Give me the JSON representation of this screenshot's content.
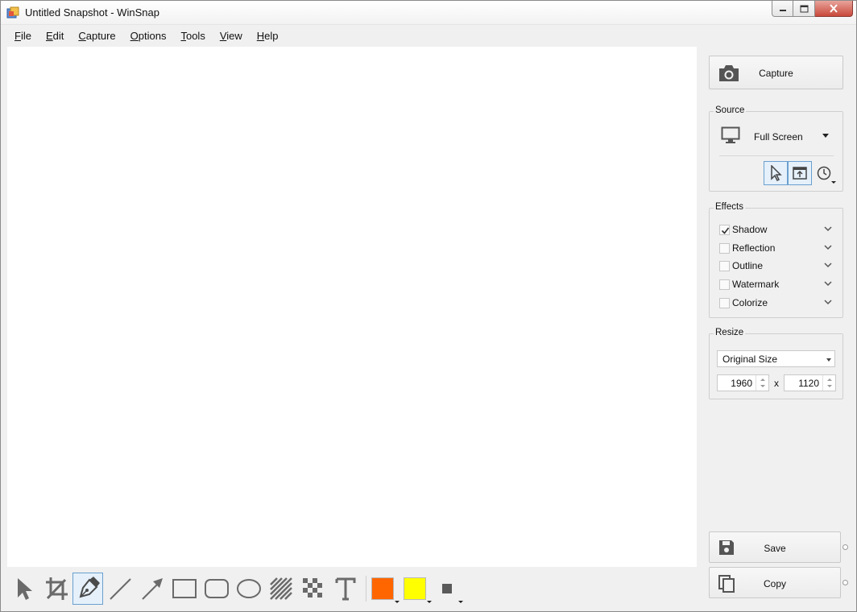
{
  "window": {
    "title": "Untitled Snapshot - WinSnap"
  },
  "menu": [
    {
      "label": "File",
      "accel": "F",
      "rest": "ile"
    },
    {
      "label": "Edit",
      "accel": "E",
      "rest": "dit"
    },
    {
      "label": "Capture",
      "accel": "C",
      "rest": "apture"
    },
    {
      "label": "Options",
      "accel": "O",
      "rest": "ptions"
    },
    {
      "label": "Tools",
      "accel": "T",
      "rest": "ools"
    },
    {
      "label": "View",
      "accel": "V",
      "rest": "iew"
    },
    {
      "label": "Help",
      "accel": "H",
      "rest": "elp"
    }
  ],
  "capture": {
    "label": "Capture",
    "icon": "camera-icon"
  },
  "source": {
    "title": "Source",
    "selected": "Full Screen",
    "icon": "monitor-icon",
    "modes": [
      "cursor-mode-icon",
      "window-mode-icon",
      "timer-icon"
    ]
  },
  "effects": {
    "title": "Effects",
    "items": [
      {
        "label": "Shadow",
        "checked": true
      },
      {
        "label": "Reflection",
        "checked": false
      },
      {
        "label": "Outline",
        "checked": false
      },
      {
        "label": "Watermark",
        "checked": false
      },
      {
        "label": "Colorize",
        "checked": false
      }
    ]
  },
  "resize": {
    "title": "Resize",
    "mode": "Original Size",
    "width": "1960",
    "separator": "x",
    "height": "1120"
  },
  "actions": {
    "save_label": "Save",
    "copy_label": "Copy"
  },
  "toolbar": {
    "tools": [
      "select-tool-icon",
      "crop-tool-icon",
      "pen-tool-icon",
      "line-tool-icon",
      "arrow-tool-icon",
      "rectangle-tool-icon",
      "rounded-rectangle-tool-icon",
      "ellipse-tool-icon",
      "hatch-tool-icon",
      "pixelate-tool-icon",
      "text-tool-icon"
    ],
    "active_tool": "pen-tool-icon",
    "primary_color": "#ff6600",
    "secondary_color": "#ffff00",
    "line_width_icon": "line-width-icon"
  }
}
